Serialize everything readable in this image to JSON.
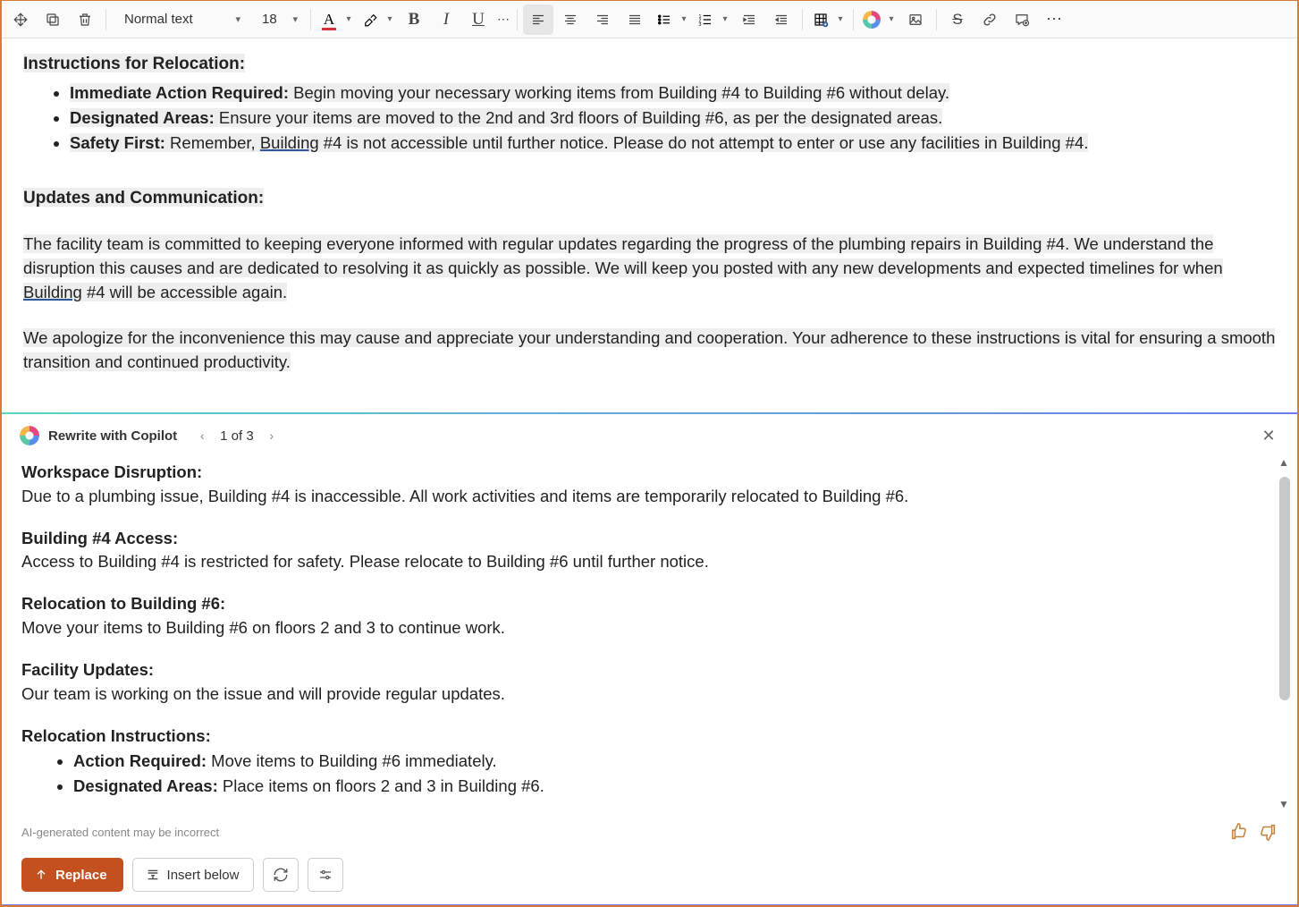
{
  "toolbar": {
    "style_text": "Normal text",
    "font_size": "18"
  },
  "document": {
    "h1": "Instructions for Relocation:",
    "li1_label": "Immediate Action Required:",
    "li1_text": " Begin moving your necessary working items from Building #4 to Building #6 without delay.",
    "li2_label": "Designated Areas:",
    "li2_text": " Ensure your items are moved to the 2nd and 3rd floors of Building #6, as per the designated areas.",
    "li3_label": "Safety First:",
    "li3_prefix": " Remember, ",
    "li3_link": "Building",
    "li3_suffix": " #4 is not accessible until further notice. Please do not attempt to enter or use any facilities in Building #4.",
    "h2": "Updates and Communication:",
    "p1_a": "The facility team is committed to keeping everyone informed with regular updates regarding the progress of the plumbing repairs in Building #4. We understand the disruption this causes and are dedicated to resolving it as quickly as possible. We will keep you posted with any new developments and expected timelines for when ",
    "p1_link": "Building",
    "p1_b": " #4 will be accessible again.",
    "p2": "We apologize for the inconvenience this may cause and appreciate your understanding and cooperation. Your adherence to these instructions is vital for ensuring a smooth transition and continued productivity."
  },
  "copilot": {
    "title": "Rewrite with Copilot",
    "counter": "1 of 3",
    "disclaimer": "AI-generated content may be incorrect",
    "replace": "Replace",
    "insert_below": "Insert below",
    "body": {
      "s1_h": "Workspace Disruption:",
      "s1_t": "Due to a plumbing issue, Building #4 is inaccessible. All work activities and items are temporarily relocated to Building #6.",
      "s2_h": "Building #4 Access:",
      "s2_t": "Access to Building #4 is restricted for safety. Please relocate to Building #6 until further notice.",
      "s3_h": "Relocation to Building #6:",
      "s3_t": "Move your items to Building #6 on floors 2 and 3 to continue work.",
      "s4_h": "Facility Updates:",
      "s4_t": "Our team is working on the issue and will provide regular updates.",
      "s5_h": "Relocation Instructions:",
      "s5_li1_l": "Action Required:",
      "s5_li1_t": " Move items to Building #6 immediately.",
      "s5_li2_l": "Designated Areas:",
      "s5_li2_t": " Place items on floors 2 and 3 in Building #6."
    }
  }
}
